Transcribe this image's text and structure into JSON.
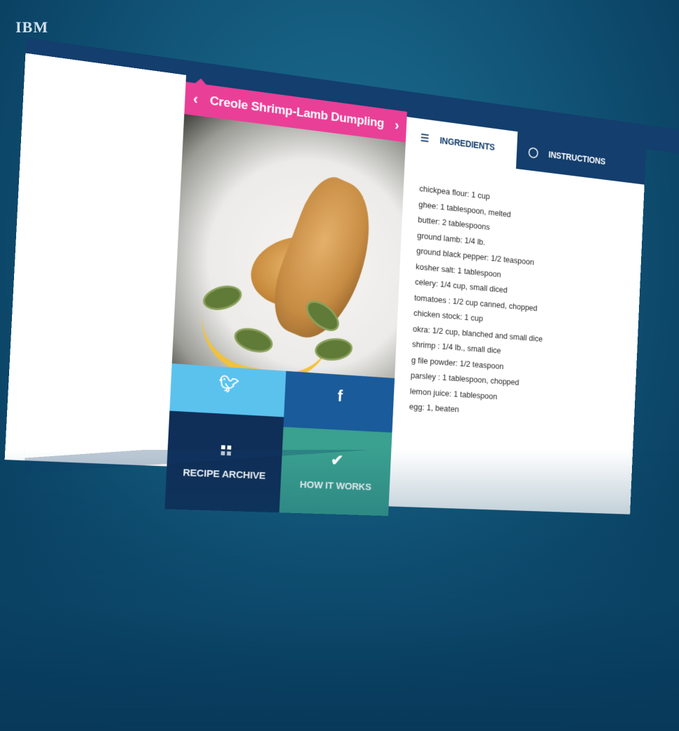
{
  "brand": {
    "logo_text": "IBM"
  },
  "recipe": {
    "prev_label": "‹",
    "next_label": "›",
    "title": "Creole Shrimp-Lamb Dumpling"
  },
  "share": {
    "twitter_icon": "twitter-icon",
    "facebook_icon": "facebook-icon",
    "recipe_archive_label": "RECIPE ARCHIVE",
    "how_it_works_label": "HOW IT WORKS"
  },
  "tabs": {
    "ingredients_label": "INGREDIENTS",
    "instructions_label": "INSTRUCTIONS"
  },
  "ingredients": [
    "chickpea flour: 1 cup",
    "ghee: 1 tablespoon, melted",
    "butter: 2 tablespoons",
    "ground lamb: 1/4 lb.",
    "ground black pepper: 1/2 teaspoon",
    "kosher salt: 1 tablespoon",
    "celery: 1/4 cup, small diced",
    "tomatoes : 1/2 cup canned, chopped",
    "chicken stock: 1 cup",
    "okra: 1/2 cup, blanched and small dice",
    "shrimp : 1/4 lb., small dice",
    "g file powder: 1/2 teaspoon",
    "parsley : 1 tablespoon, chopped",
    "lemon juice: 1 tablespoon",
    "egg: 1, beaten"
  ],
  "colors": {
    "title_pink": "#e93f97",
    "navy": "#133e6d",
    "twitter_blue": "#5bc2ee",
    "facebook_blue": "#1a5b9b",
    "archive_navy": "#0f2e58",
    "how_teal": "#3aa08f",
    "background_blue": "#155d80"
  }
}
